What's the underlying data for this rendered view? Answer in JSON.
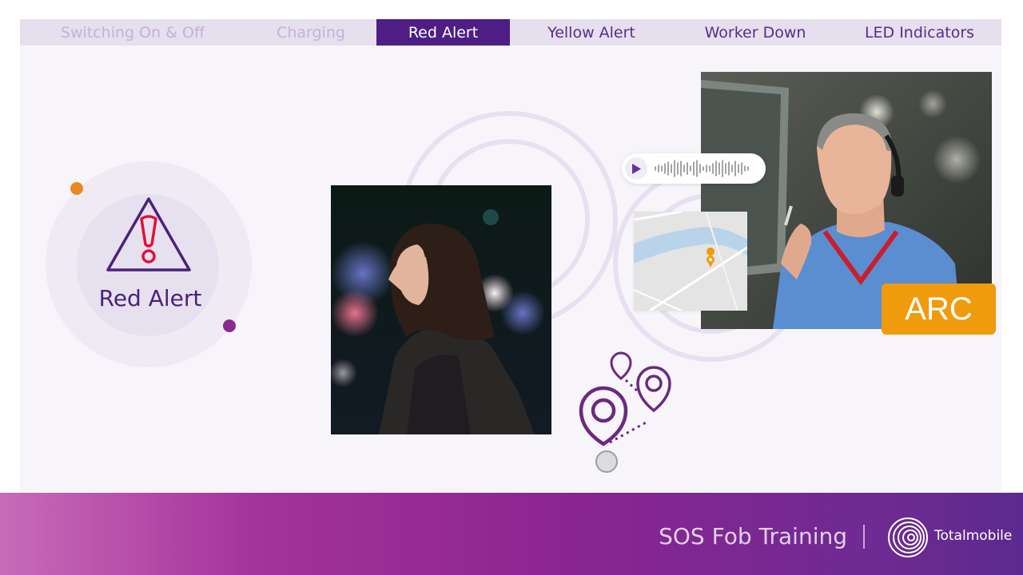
{
  "tabs": [
    {
      "label": "Switching On & Off",
      "state": "dim"
    },
    {
      "label": "Charging",
      "state": "dim"
    },
    {
      "label": "Red Alert",
      "state": "active"
    },
    {
      "label": "Yellow Alert",
      "state": "normal"
    },
    {
      "label": "Worker Down",
      "state": "normal"
    },
    {
      "label": "LED Indicators",
      "state": "normal"
    }
  ],
  "alert": {
    "label": "Red Alert",
    "icon": "warning-triangle-icon"
  },
  "badge": {
    "label": "ARC"
  },
  "footer": {
    "title": "SOS Fob Training",
    "brand": "Totalmobile"
  },
  "colors": {
    "active_tab": "#4e1e84",
    "accent_orange": "#f09b0d",
    "alert_red": "#e0123a",
    "brand_purple": "#5a2d86"
  }
}
